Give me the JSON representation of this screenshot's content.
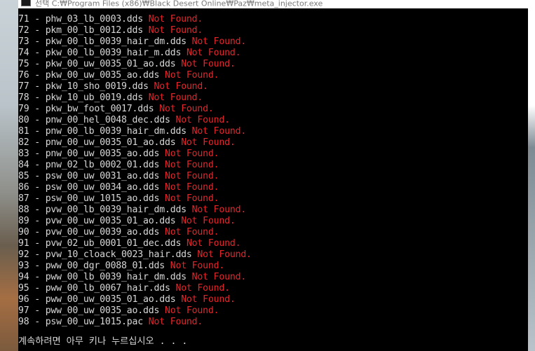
{
  "window": {
    "title": "선택 C:₩Program Files (x86)₩Black Desert Online₩Paz₩meta_injector.exe"
  },
  "console": {
    "lines": [
      {
        "text": "71 - phw_03_lb_0003.dds ",
        "status": "Not Found."
      },
      {
        "text": "72 - pkm_00_lb_0012.dds ",
        "status": "Not Found."
      },
      {
        "text": "73 - pkw_00_lb_0039_hair_dm.dds ",
        "status": "Not Found."
      },
      {
        "text": "74 - pkw_00_lb_0039_hair_m.dds ",
        "status": "Not Found."
      },
      {
        "text": "75 - pkw_00_uw_0035_01_ao.dds ",
        "status": "Not Found."
      },
      {
        "text": "76 - pkw_00_uw_0035_ao.dds ",
        "status": "Not Found."
      },
      {
        "text": "77 - pkw_10_sho_0019.dds ",
        "status": "Not Found."
      },
      {
        "text": "78 - pkw_10_ub_0019.dds ",
        "status": "Not Found."
      },
      {
        "text": "79 - pkw_bw_foot_0017.dds ",
        "status": "Not Found."
      },
      {
        "text": "80 - pnw_00_hel_0048_dec.dds ",
        "status": "Not Found."
      },
      {
        "text": "81 - pnw_00_lb_0039_hair_dm.dds ",
        "status": "Not Found."
      },
      {
        "text": "82 - pnw_00_uw_0035_01_ao.dds ",
        "status": "Not Found."
      },
      {
        "text": "83 - pnw_00_uw_0035_ao.dds ",
        "status": "Not Found."
      },
      {
        "text": "84 - pnw_02_lb_0002_01.dds ",
        "status": "Not Found."
      },
      {
        "text": "85 - psw_00_uw_0031_ao.dds ",
        "status": "Not Found."
      },
      {
        "text": "86 - psw_00_uw_0034_ao.dds ",
        "status": "Not Found."
      },
      {
        "text": "87 - psw_00_uw_1015_ao.dds ",
        "status": "Not Found."
      },
      {
        "text": "88 - pvw_00_lb_0039_hair_dm.dds ",
        "status": "Not Found."
      },
      {
        "text": "89 - pvw_00_uw_0035_01_ao.dds ",
        "status": "Not Found."
      },
      {
        "text": "90 - pvw_00_uw_0039_ao.dds ",
        "status": "Not Found."
      },
      {
        "text": "91 - pvw_02_ub_0001_01_dec.dds ",
        "status": "Not Found."
      },
      {
        "text": "92 - pvw_10_cloack_0023_hair.dds ",
        "status": "Not Found."
      },
      {
        "text": "93 - pww_00_dgr_0088_01.dds ",
        "status": "Not Found."
      },
      {
        "text": "94 - pww_00_lb_0039_hair_dm.dds ",
        "status": "Not Found."
      },
      {
        "text": "95 - pww_00_lb_0067_hair.dds ",
        "status": "Not Found."
      },
      {
        "text": "96 - pww_00_uw_0035_01_ao.dds ",
        "status": "Not Found."
      },
      {
        "text": "97 - pww_00_uw_0035_ao.dds ",
        "status": "Not Found."
      },
      {
        "text": "98 - psw_00_uw_1015.pac ",
        "status": "Not Found."
      }
    ],
    "prompt": "계속하려면 아무 키나 누르십시오 . . ."
  },
  "colors": {
    "background": "#000000",
    "text": "#d8d8d8",
    "status_error": "#e3262b"
  }
}
